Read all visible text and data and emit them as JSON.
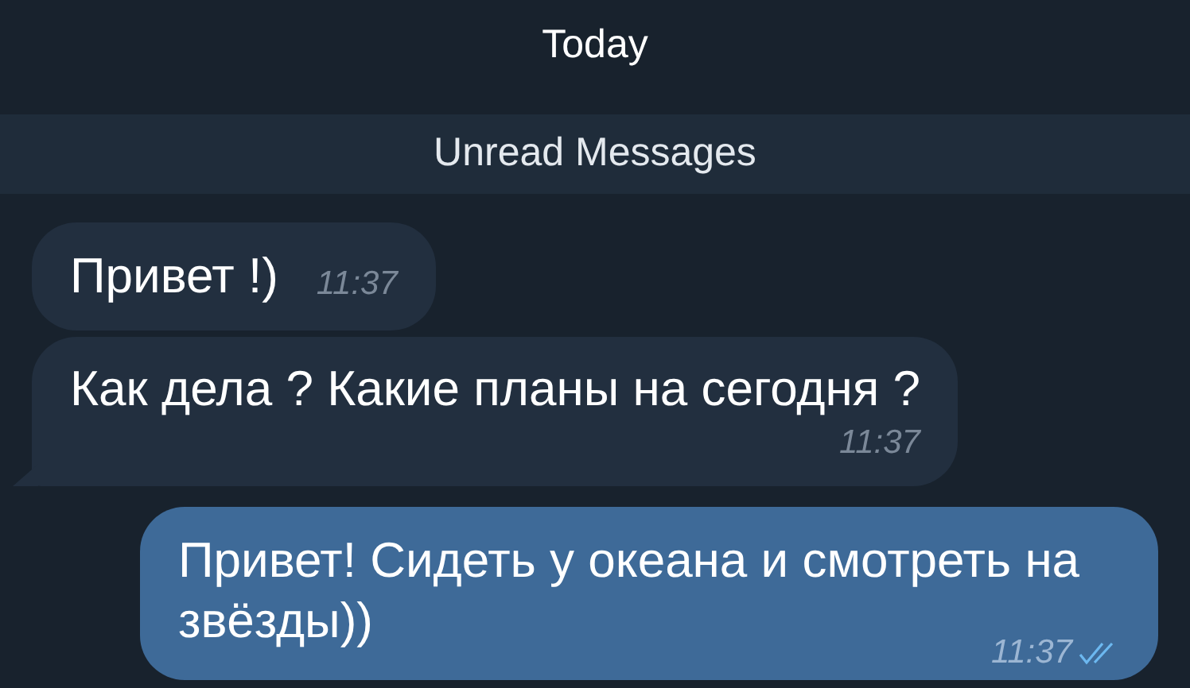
{
  "header": {
    "title": "Today"
  },
  "unread_banner": {
    "text": "Unread Messages"
  },
  "messages": [
    {
      "kind": "incoming_compact",
      "text": "Привет !)",
      "time": "11:37",
      "tail": false
    },
    {
      "kind": "incoming",
      "text": "Как дела ? Какие планы на сегодня ?",
      "time": "11:37",
      "tail": true
    },
    {
      "kind": "outgoing",
      "text": "Привет! Сидеть у океана и смотреть на звёзды))",
      "time": "11:37",
      "tail": false,
      "read": true
    }
  ]
}
